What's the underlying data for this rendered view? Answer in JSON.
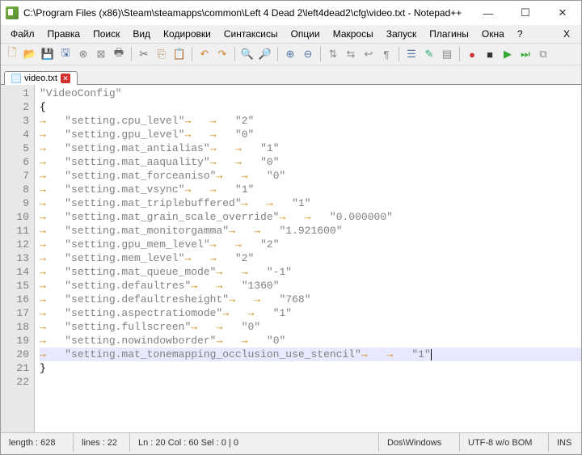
{
  "window": {
    "title": "C:\\Program Files (x86)\\Steam\\steamapps\\common\\Left 4 Dead 2\\left4dead2\\cfg\\video.txt - Notepad++"
  },
  "menu": {
    "items": [
      "Файл",
      "Правка",
      "Поиск",
      "Вид",
      "Кодировки",
      "Синтаксисы",
      "Опции",
      "Макросы",
      "Запуск",
      "Плагины",
      "Окна",
      "?"
    ],
    "x": "X"
  },
  "tab": {
    "label": "video.txt"
  },
  "code": {
    "header": "\"VideoConfig\"",
    "open": "{",
    "close": "}",
    "settings": [
      {
        "key": "\"setting.cpu_level\"",
        "tabs": 2,
        "val": "\"2\""
      },
      {
        "key": "\"setting.gpu_level\"",
        "tabs": 2,
        "val": "\"0\""
      },
      {
        "key": "\"setting.mat_antialias\"",
        "tabs": 2,
        "val": "\"1\""
      },
      {
        "key": "\"setting.mat_aaquality\"",
        "tabs": 2,
        "val": "\"0\""
      },
      {
        "key": "\"setting.mat_forceaniso\"",
        "tabs": 2,
        "val": "\"0\""
      },
      {
        "key": "\"setting.mat_vsync\"",
        "tabs": 2,
        "val": "\"1\""
      },
      {
        "key": "\"setting.mat_triplebuffered\"",
        "tabs": 2,
        "val": "\"1\""
      },
      {
        "key": "\"setting.mat_grain_scale_override\"",
        "tabs": 2,
        "val": "\"0.000000\""
      },
      {
        "key": "\"setting.mat_monitorgamma\"",
        "tabs": 2,
        "val": "\"1.921600\""
      },
      {
        "key": "\"setting.gpu_mem_level\"",
        "tabs": 2,
        "val": "\"2\""
      },
      {
        "key": "\"setting.mem_level\"",
        "tabs": 2,
        "val": "\"2\""
      },
      {
        "key": "\"setting.mat_queue_mode\"",
        "tabs": 2,
        "val": "\"-1\""
      },
      {
        "key": "\"setting.defaultres\"",
        "tabs": 2,
        "val": "\"1360\""
      },
      {
        "key": "\"setting.defaultresheight\"",
        "tabs": 2,
        "val": "\"768\""
      },
      {
        "key": "\"setting.aspectratiomode\"",
        "tabs": 2,
        "val": "\"1\""
      },
      {
        "key": "\"setting.fullscreen\"",
        "tabs": 2,
        "val": "\"0\""
      },
      {
        "key": "\"setting.nowindowborder\"",
        "tabs": 2,
        "val": "\"0\""
      },
      {
        "key": "\"setting.mat_tonemapping_occlusion_use_stencil\"",
        "tabs": 2,
        "val": "\"1\"",
        "current": true
      }
    ]
  },
  "status": {
    "length": "length : 628",
    "lines": "lines : 22",
    "pos": "Ln : 20   Col : 60   Sel : 0 | 0",
    "eol": "Dos\\Windows",
    "enc": "UTF-8 w/o BOM",
    "mode": "INS"
  }
}
